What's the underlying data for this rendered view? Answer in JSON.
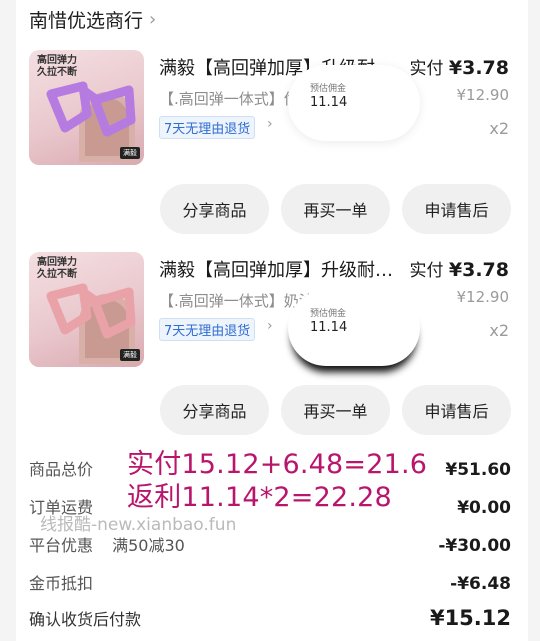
{
  "shop": {
    "name": "南惜优选商行",
    "chevron": "›"
  },
  "items": [
    {
      "thumb_caption_1": "高回弹力",
      "thumb_caption_2": "久拉不断",
      "thumb_tag": "满毅",
      "thumb_color": "#b57be0",
      "title": "满毅【高回弹加厚】升级耐",
      "spec": "【.高回弹一体式】优",
      "badge": "7天无理由退货",
      "paid_label": "实付",
      "paid_value": "¥3.78",
      "original_price": "¥12.90",
      "quantity": "x2",
      "commission_label": "预估佣金",
      "commission_value": "11.14"
    },
    {
      "thumb_caption_1": "高回弹力",
      "thumb_caption_2": "久拉不断",
      "thumb_tag": "满毅",
      "thumb_color": "#e8a2a8",
      "title": "满毅【高回弹加厚】升级耐…",
      "spec": "【.高回弹一体式】奶油粉",
      "badge": "7天无理由退货",
      "paid_label": "实付",
      "paid_value": "¥3.78",
      "original_price": "¥12.90",
      "quantity": "x2",
      "commission_label": "预估佣金",
      "commission_value": "11.14"
    }
  ],
  "buttons": {
    "share": "分享商品",
    "rebuy": "再买一单",
    "after_sale": "申请售后"
  },
  "summary": {
    "goods_total_label": "商品总价",
    "goods_total_value": "¥51.60",
    "shipping_label": "订单运费",
    "shipping_value": "¥0.00",
    "platform_discount_label": "平台优惠",
    "platform_discount_promo": "满50减30",
    "platform_discount_value": "-¥30.00",
    "coin_label": "金币抵扣",
    "coin_value": "-¥6.48",
    "confirm_label": "确认收货后付款",
    "confirm_value": "¥15.12"
  },
  "overlay": {
    "line1": "实付15.12+6.48=21.6",
    "line2": "返利11.14*2=22.28",
    "color": "#b8166d"
  },
  "watermark": "线报酷-new.xianbao.fun"
}
